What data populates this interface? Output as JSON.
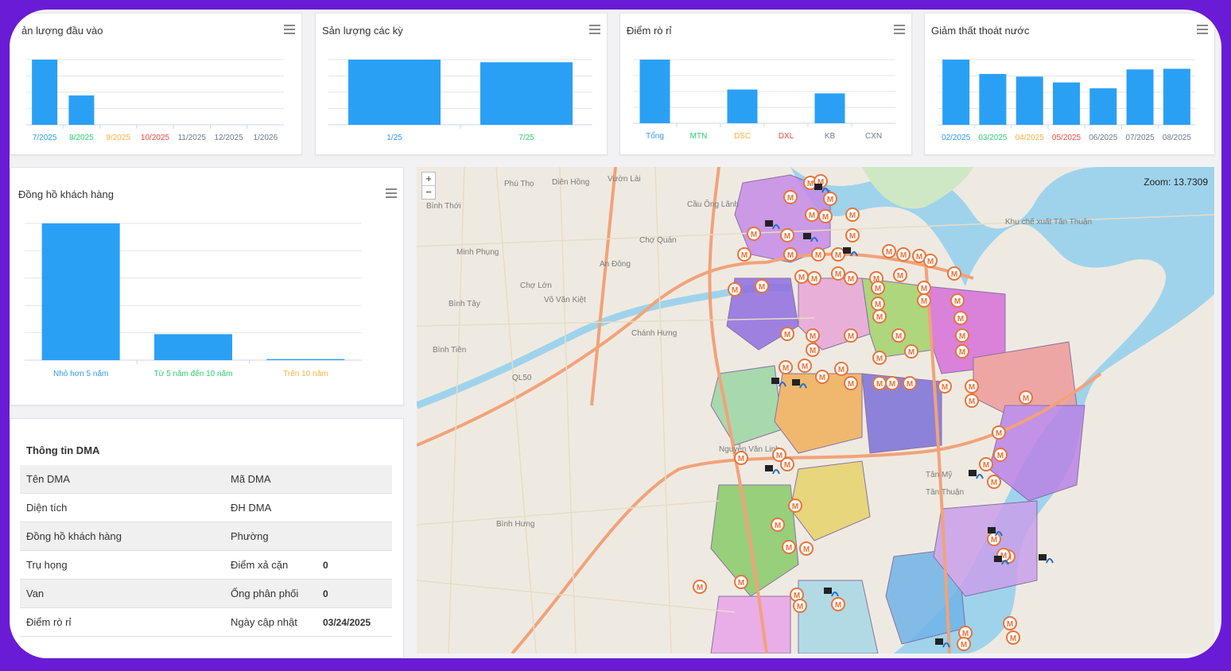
{
  "charts": {
    "input": {
      "title": "ản lượng đầu vào",
      "categories": [
        "7/2025",
        "8/2025",
        "9/2025",
        "10/2025",
        "11/2025",
        "12/2025",
        "1/2026"
      ],
      "values": [
        100,
        45,
        0,
        0,
        0,
        0,
        0
      ],
      "label_colors": [
        "#2e9be8",
        "#2ecc71",
        "#f5b041",
        "#e74c3c",
        "#6f7b8a",
        "#6f7b8a",
        "#6f7b8a"
      ]
    },
    "period": {
      "title": "Sản lượng các kỳ",
      "categories": [
        "1/25",
        "7/25"
      ],
      "values": [
        100,
        96
      ],
      "label_colors": [
        "#2e9be8",
        "#2ecc71"
      ]
    },
    "leak": {
      "title": "Điểm rò rỉ",
      "categories": [
        "Tổng",
        "MTN",
        "DSC",
        "DXL",
        "KB",
        "CXN"
      ],
      "values": [
        100,
        0,
        53,
        0,
        47,
        0
      ],
      "label_colors": [
        "#2e9be8",
        "#2ecc71",
        "#f5b041",
        "#e74c3c",
        "#6f7b8a",
        "#6f7b8a"
      ]
    },
    "loss": {
      "title": "Giảm thất thoát nước",
      "categories": [
        "02/2025",
        "03/2025",
        "04/2025",
        "05/2025",
        "06/2025",
        "07/2025",
        "08/2025"
      ],
      "values": [
        100,
        78,
        74,
        65,
        56,
        85,
        86
      ],
      "label_colors": [
        "#2e9be8",
        "#2ecc71",
        "#f5b041",
        "#e74c3c",
        "#6f7b8a",
        "#6f7b8a",
        "#6f7b8a"
      ]
    },
    "meters": {
      "title": "Đồng hồ khách hàng",
      "categories": [
        "Nhỏ hơn 5 năm",
        "Từ 5 năm đến 10 năm",
        "Trên 10 năm"
      ],
      "values": [
        100,
        19,
        0.8
      ],
      "label_colors": [
        "#2e9be8",
        "#2ecc71",
        "#f5b041"
      ]
    }
  },
  "chart_data": [
    {
      "type": "bar",
      "title": "ản lượng đầu vào",
      "categories": [
        "7/2025",
        "8/2025",
        "9/2025",
        "10/2025",
        "11/2025",
        "12/2025",
        "1/2026"
      ],
      "values": [
        100,
        45,
        0,
        0,
        0,
        0,
        0
      ]
    },
    {
      "type": "bar",
      "title": "Sản lượng các kỳ",
      "categories": [
        "1/25",
        "7/25"
      ],
      "values": [
        100,
        96
      ]
    },
    {
      "type": "bar",
      "title": "Điểm rò rỉ",
      "categories": [
        "Tổng",
        "MTN",
        "DSC",
        "DXL",
        "KB",
        "CXN"
      ],
      "values": [
        100,
        0,
        53,
        0,
        47,
        0
      ]
    },
    {
      "type": "bar",
      "title": "Giảm thất thoát nước",
      "categories": [
        "02/2025",
        "03/2025",
        "04/2025",
        "05/2025",
        "06/2025",
        "07/2025",
        "08/2025"
      ],
      "values": [
        100,
        78,
        74,
        65,
        56,
        85,
        86
      ]
    },
    {
      "type": "bar",
      "title": "Đồng hồ khách hàng",
      "categories": [
        "Nhỏ hơn 5 năm",
        "Từ 5 năm đến 10 năm",
        "Trên 10 năm"
      ],
      "values": [
        100,
        19,
        0.8
      ]
    }
  ],
  "bar_color": "#2aa0f5",
  "dma": {
    "title": "Thông tin DMA",
    "rows": [
      {
        "l1": "Tên DMA",
        "v1": "",
        "l2": "Mã DMA",
        "v2": ""
      },
      {
        "l1": "Diện tích",
        "v1": "",
        "l2": "ĐH DMA",
        "v2": ""
      },
      {
        "l1": "Đồng hồ khách hàng",
        "v1": "",
        "l2": "Phường",
        "v2": ""
      },
      {
        "l1": "Trụ họng",
        "v1": "",
        "l2": "Điểm xả cặn",
        "v2": "0"
      },
      {
        "l1": "Van",
        "v1": "",
        "l2": "Ống phân phối",
        "v2": "0"
      },
      {
        "l1": "Điểm rò rỉ",
        "v1": "",
        "l2": "Ngày cập nhật",
        "v2": "03/24/2025"
      }
    ]
  },
  "map": {
    "zoom_label": "Zoom: 13.7309",
    "zoom_in": "+",
    "zoom_out": "−",
    "marker_glyph": "M",
    "marker_color": "#e8743b",
    "river_color": "#9fd3ec",
    "road_color": "#f2a27a",
    "place_labels": [
      "Phú Thọ",
      "Diên Hồng",
      "Vườn Lài",
      "Bình Thới",
      "Cầu Ông Lãnh",
      "Minh Phụng",
      "Chợ Quán",
      "An Đông",
      "Chợ Lớn",
      "Bình Tây",
      "Chánh Hưng",
      "Bình Tiên",
      "Tân Mỹ",
      "Tân Thuận",
      "Bình Hưng",
      "Khu chế xuất Tân Thuận",
      "Nguyễn Văn Linh",
      "QL50",
      "Võ Văn Kiệt"
    ]
  }
}
